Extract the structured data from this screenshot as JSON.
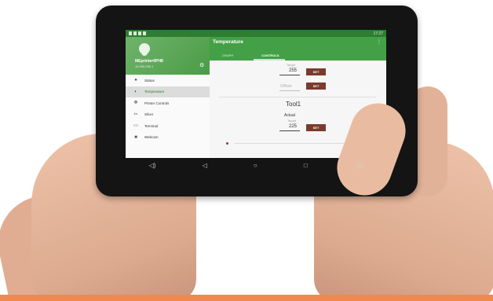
{
  "status_bar": {
    "time": "17:27"
  },
  "drawer": {
    "title": "MEprinter6PH8",
    "subtitle": "10.200.200.1",
    "items": [
      {
        "label": "Status",
        "icon": "info-icon"
      },
      {
        "label": "Temperature",
        "icon": "thermometer-icon"
      },
      {
        "label": "Printer Controls",
        "icon": "move-icon"
      },
      {
        "label": "Slicer",
        "icon": "scissors-icon"
      },
      {
        "label": "Terminal",
        "icon": "terminal-icon"
      },
      {
        "label": "Webcam",
        "icon": "webcam-icon"
      }
    ],
    "active_index": 1
  },
  "toolbar": {
    "title": "Temperature",
    "tabs": [
      "GRAPH",
      "CONTROLS"
    ],
    "active_tab": "CONTROLS"
  },
  "bed": {
    "target_label": "Target",
    "target_value": "255",
    "set_label": "SET",
    "offset_label": "Offset",
    "offset_set_label": "SET"
  },
  "tool": {
    "title": "Tool1",
    "actual_label": "Actual",
    "target_label": "Target",
    "target_value": "225",
    "set_label": "SET"
  },
  "colors": {
    "primary": "#43a047",
    "set_button": "#7a3b2e",
    "accent_strip": "#f0894f"
  }
}
